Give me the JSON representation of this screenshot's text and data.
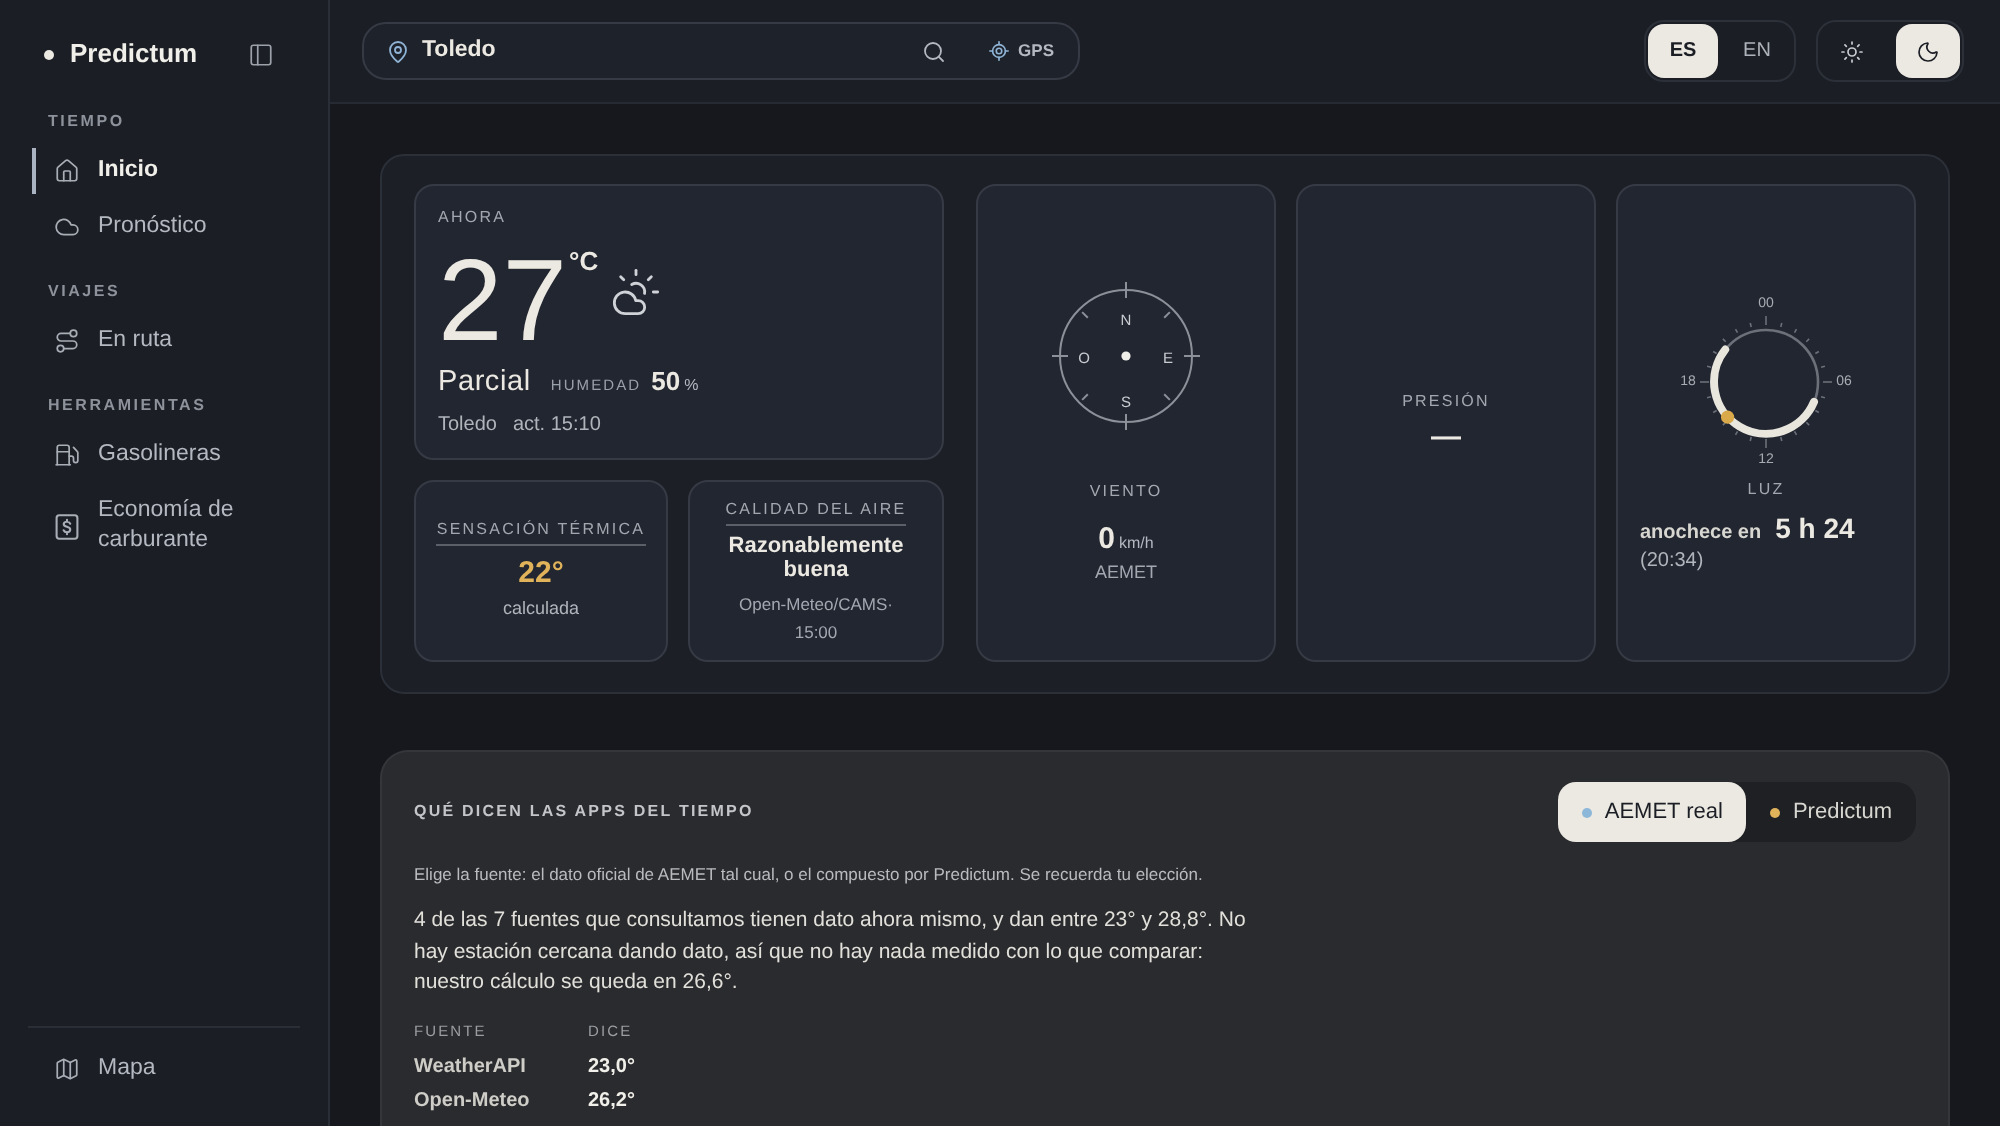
{
  "sidebar": {
    "brand": "Predictum",
    "sections": [
      {
        "title": "TIEMPO",
        "items": [
          {
            "label": "Inicio",
            "selected": true
          },
          {
            "label": "Pronóstico",
            "selected": false
          }
        ]
      },
      {
        "title": "VIAJES",
        "items": [
          {
            "label": "En ruta",
            "selected": false
          }
        ]
      },
      {
        "title": "HERRAMIENTAS",
        "items": [
          {
            "label": "Gasolineras",
            "selected": false
          },
          {
            "label": "Economía de carburante",
            "selected": false
          }
        ]
      }
    ],
    "footer_items": [
      {
        "label": "Mapa",
        "selected": false
      }
    ]
  },
  "topbar": {
    "search": {
      "value": "Toledo"
    },
    "gps_button": "GPS",
    "languages": [
      {
        "label": "ES",
        "selected": true
      },
      {
        "label": "EN",
        "selected": false
      }
    ],
    "theme_buttons": [
      {
        "kind": "light",
        "selected": false
      },
      {
        "kind": "dark",
        "selected": true
      }
    ]
  },
  "now": {
    "label": "AHORA",
    "temperature": "27",
    "unit": "°C",
    "condition": "Parcial",
    "humidity_label": "HUMEDAD",
    "humidity": "50",
    "humidity_unit": "%",
    "location": "Toledo",
    "updated": "act. 15:10"
  },
  "feels_like": {
    "label": "SENSACIÓN TÉRMICA",
    "value": "22°",
    "note": "calculada"
  },
  "air_quality": {
    "label": "CALIDAD DEL AIRE",
    "value": "Razonablemente buena",
    "source": "Open-Meteo/CAMS· 15:00"
  },
  "wind": {
    "compass_labels": [
      "N",
      "E",
      "S",
      "O"
    ],
    "label": "VIENTO",
    "value": "0",
    "unit": "km/h",
    "source": "AEMET"
  },
  "pressure": {
    "label": "PRESIÓN",
    "value": "—"
  },
  "light": {
    "dial_labels": [
      "00",
      "06",
      "12",
      "18"
    ],
    "label": "LUZ",
    "text": "anochece en",
    "value": "5 h 24",
    "time": "(20:34)"
  },
  "apps_panel": {
    "title": "QUÉ DICEN LAS APPS DEL TIEMPO",
    "sources": [
      {
        "label": "AEMET real",
        "selected": true,
        "color": "#8cb7d9"
      },
      {
        "label": "Predictum",
        "selected": false,
        "color": "#e0b25a"
      }
    ],
    "hint": "Elige la fuente: el dato oficial de AEMET tal cual, o el compuesto por Predictum. Se recuerda tu elección.",
    "summary": "4 de las 7 fuentes que consultamos tienen dato ahora mismo, y dan entre 23° y 28,8°. No hay estación cercana dando dato, así que no hay nada medido con lo que comparar: nuestro cálculo se queda en 26,6°.",
    "table": {
      "columns": [
        "FUENTE",
        "DICE"
      ],
      "rows": [
        [
          "WeatherAPI",
          "23,0°"
        ],
        [
          "Open-Meteo",
          "26,2°"
        ]
      ]
    }
  }
}
